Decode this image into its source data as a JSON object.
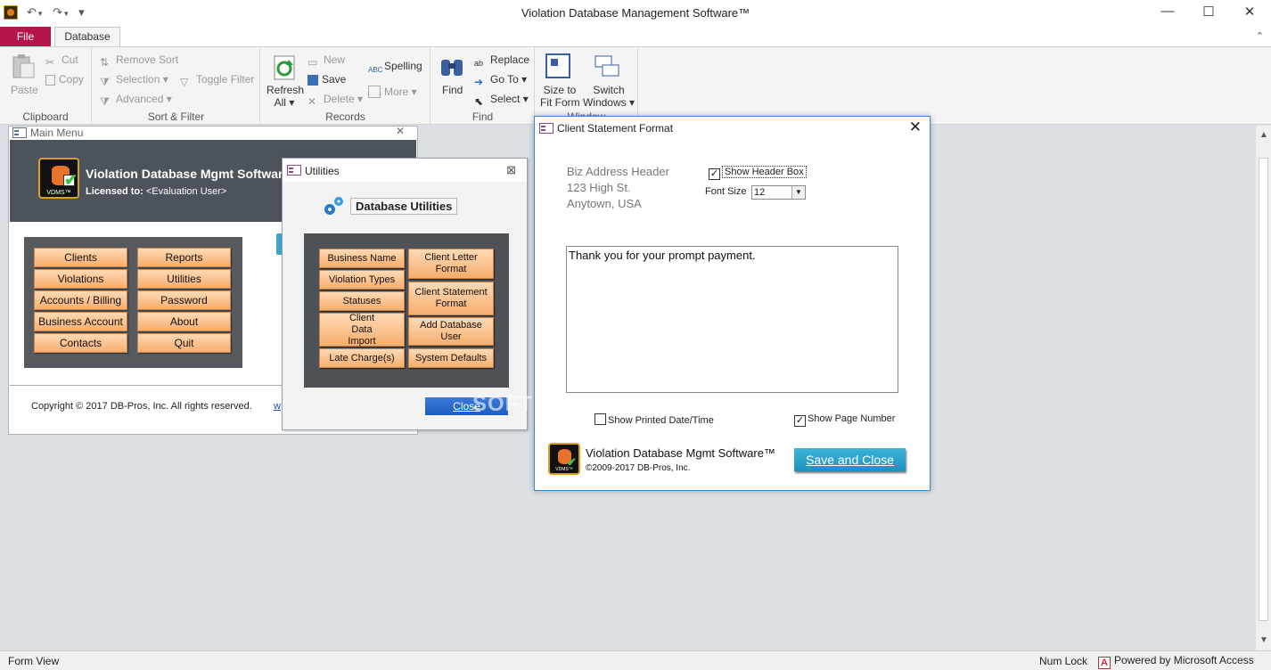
{
  "window": {
    "title": "Violation Database Management Software™",
    "minimize": "—",
    "maximize": "☐",
    "close": "✕"
  },
  "qat": {
    "undo": "↶",
    "redo": "↷",
    "customize": "▾"
  },
  "tabs": {
    "file": "File",
    "database": "Database",
    "collapse": "⌃"
  },
  "ribbon": {
    "clipboard": {
      "label": "Clipboard",
      "paste": "Paste",
      "cut": "Cut",
      "copy": "Copy"
    },
    "sortfilter": {
      "label": "Sort & Filter",
      "remove_sort": "Remove Sort",
      "selection": "Selection",
      "advanced": "Advanced",
      "toggle_filter": "Toggle Filter"
    },
    "records": {
      "label": "Records",
      "refresh_all_1": "Refresh",
      "refresh_all_2": "All",
      "new": "New",
      "save": "Save",
      "delete": "Delete",
      "spelling": "Spelling",
      "more": "More"
    },
    "find": {
      "label": "Find",
      "find": "Find",
      "replace": "Replace",
      "goto": "Go To",
      "select": "Select"
    },
    "window": {
      "label": "Window",
      "size_to_fit_1": "Size to",
      "size_to_fit_2": "Fit Form",
      "switch_windows_1": "Switch",
      "switch_windows_2": "Windows"
    }
  },
  "main_menu": {
    "title": "Main Menu",
    "app_title": "Violation Database Mgmt Software™",
    "licensed_label": "Licensed to:",
    "licensed_value": "<Evaluation User>",
    "logo_text": "VDMS™",
    "buttons_left": [
      "Clients",
      "Violations",
      "Accounts / Billing",
      "Business Account",
      "Contacts"
    ],
    "buttons_right": [
      "Reports",
      "Utilities",
      "Password",
      "About",
      "Quit"
    ],
    "copyright": "Copyright © 2017 DB-Pros, Inc.  All rights reserved.",
    "link": "w"
  },
  "utilities": {
    "title": "Utilities",
    "heading": "Database Utilities",
    "buttons_left": [
      "Business Name",
      "Violation Types",
      "Statuses",
      "Client Data Import",
      "Late Charge(s)"
    ],
    "buttons_right": [
      "Client Letter Format",
      "Client Statement Format",
      "Add Database User",
      "System Defaults"
    ],
    "close": "Close"
  },
  "client_statement": {
    "title": "Client Statement Format",
    "address": [
      "Biz Address Header",
      "123 High St.",
      "Anytown, USA"
    ],
    "show_header_box": "Show Header Box",
    "show_header_box_checked": true,
    "font_size_label": "Font Size",
    "font_size_value": "12",
    "message": "Thank you for your prompt payment.",
    "show_printed_date": "Show Printed Date/Time",
    "show_printed_date_checked": false,
    "show_page_number": "Show Page Number",
    "show_page_number_checked": true,
    "app_title": "Violation Database Mgmt Software™",
    "copyright": "©2009-2017 DB-Pros, Inc.",
    "save_close": "Save and Close"
  },
  "statusbar": {
    "view": "Form View",
    "numlock": "Num Lock",
    "powered": "Powered by Microsoft Access"
  },
  "watermark": "SOFTPEDIA"
}
